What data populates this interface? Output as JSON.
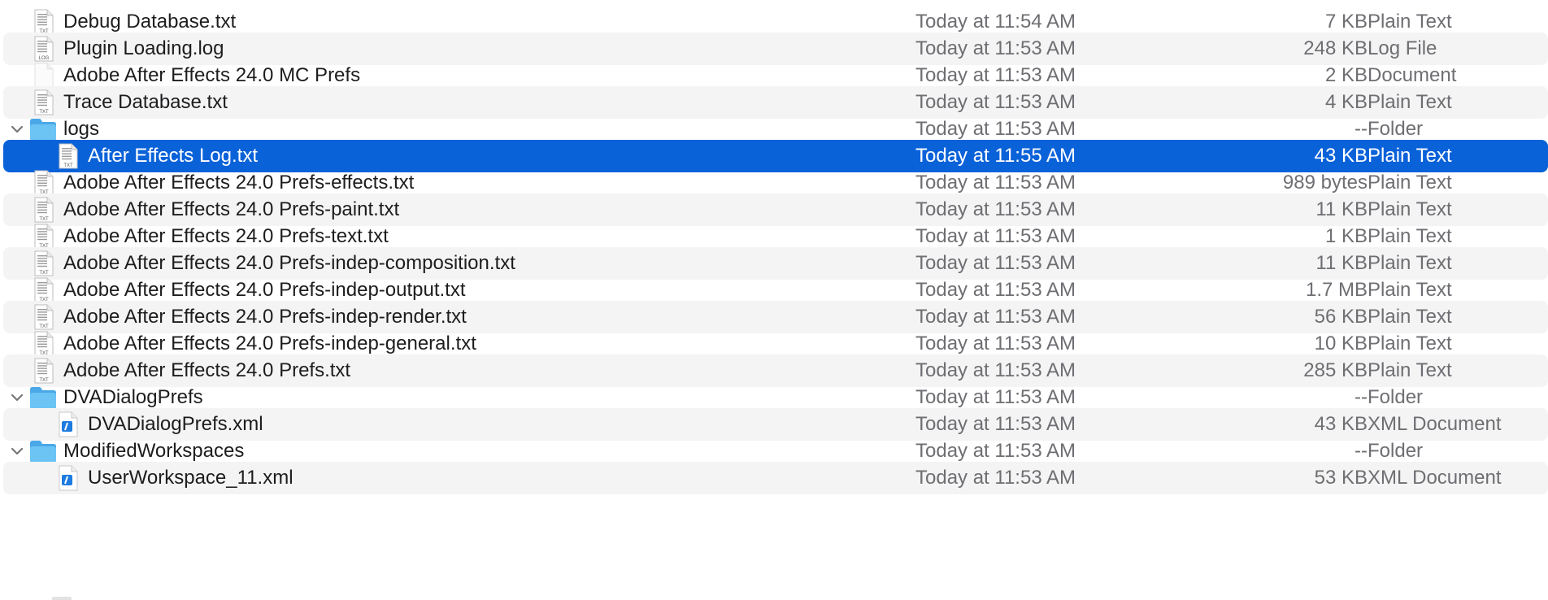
{
  "file_list": {
    "rows": [
      {
        "name": "Debug Database.txt",
        "date": "Today at 11:54 AM",
        "size": "7 KB",
        "kind": "Plain Text",
        "icon": "txt-file-icon",
        "level": 1,
        "disclosure": false,
        "selected": false
      },
      {
        "name": "Plugin Loading.log",
        "date": "Today at 11:53 AM",
        "size": "248 KB",
        "kind": "Log File",
        "icon": "log-file-icon",
        "level": 1,
        "disclosure": false,
        "selected": false
      },
      {
        "name": "Adobe After Effects 24.0 MC Prefs",
        "date": "Today at 11:53 AM",
        "size": "2 KB",
        "kind": "Document",
        "icon": "blank-document-icon",
        "level": 1,
        "disclosure": false,
        "selected": false
      },
      {
        "name": "Trace Database.txt",
        "date": "Today at 11:53 AM",
        "size": "4 KB",
        "kind": "Plain Text",
        "icon": "txt-file-icon",
        "level": 1,
        "disclosure": false,
        "selected": false
      },
      {
        "name": "logs",
        "date": "Today at 11:53 AM",
        "size": "--",
        "kind": "Folder",
        "icon": "folder-icon",
        "level": 1,
        "disclosure": true,
        "selected": false
      },
      {
        "name": "After Effects Log.txt",
        "date": "Today at 11:55 AM",
        "size": "43 KB",
        "kind": "Plain Text",
        "icon": "txt-file-icon",
        "level": 2,
        "disclosure": false,
        "selected": true
      },
      {
        "name": "Adobe After Effects 24.0 Prefs-effects.txt",
        "date": "Today at 11:53 AM",
        "size": "989 bytes",
        "kind": "Plain Text",
        "icon": "txt-file-icon",
        "level": 1,
        "disclosure": false,
        "selected": false
      },
      {
        "name": "Adobe After Effects 24.0 Prefs-paint.txt",
        "date": "Today at 11:53 AM",
        "size": "11 KB",
        "kind": "Plain Text",
        "icon": "txt-file-icon",
        "level": 1,
        "disclosure": false,
        "selected": false
      },
      {
        "name": "Adobe After Effects 24.0 Prefs-text.txt",
        "date": "Today at 11:53 AM",
        "size": "1 KB",
        "kind": "Plain Text",
        "icon": "txt-file-icon",
        "level": 1,
        "disclosure": false,
        "selected": false
      },
      {
        "name": "Adobe After Effects 24.0 Prefs-indep-composition.txt",
        "date": "Today at 11:53 AM",
        "size": "11 KB",
        "kind": "Plain Text",
        "icon": "txt-file-icon",
        "level": 1,
        "disclosure": false,
        "selected": false
      },
      {
        "name": "Adobe After Effects 24.0 Prefs-indep-output.txt",
        "date": "Today at 11:53 AM",
        "size": "1.7 MB",
        "kind": "Plain Text",
        "icon": "txt-file-icon",
        "level": 1,
        "disclosure": false,
        "selected": false
      },
      {
        "name": "Adobe After Effects 24.0 Prefs-indep-render.txt",
        "date": "Today at 11:53 AM",
        "size": "56 KB",
        "kind": "Plain Text",
        "icon": "txt-file-icon",
        "level": 1,
        "disclosure": false,
        "selected": false
      },
      {
        "name": "Adobe After Effects 24.0 Prefs-indep-general.txt",
        "date": "Today at 11:53 AM",
        "size": "10 KB",
        "kind": "Plain Text",
        "icon": "txt-file-icon",
        "level": 1,
        "disclosure": false,
        "selected": false
      },
      {
        "name": "Adobe After Effects 24.0 Prefs.txt",
        "date": "Today at 11:53 AM",
        "size": "285 KB",
        "kind": "Plain Text",
        "icon": "txt-file-icon",
        "level": 1,
        "disclosure": false,
        "selected": false
      },
      {
        "name": "DVADialogPrefs",
        "date": "Today at 11:53 AM",
        "size": "--",
        "kind": "Folder",
        "icon": "folder-icon",
        "level": 1,
        "disclosure": true,
        "selected": false
      },
      {
        "name": "DVADialogPrefs.xml",
        "date": "Today at 11:53 AM",
        "size": "43 KB",
        "kind": "XML Document",
        "icon": "xml-file-icon",
        "level": 2,
        "disclosure": false,
        "selected": false
      },
      {
        "name": "ModifiedWorkspaces",
        "date": "Today at 11:53 AM",
        "size": "--",
        "kind": "Folder",
        "icon": "folder-icon",
        "level": 1,
        "disclosure": true,
        "selected": false
      },
      {
        "name": "UserWorkspace_11.xml",
        "date": "Today at 11:53 AM",
        "size": "53 KB",
        "kind": "XML Document",
        "icon": "xml-file-icon",
        "level": 2,
        "disclosure": false,
        "selected": false
      }
    ]
  },
  "colors": {
    "selection": "#0a62d9",
    "alt_row": "#f4f4f4",
    "folder": "#5ab8f0",
    "secondary_text": "#6e6e73"
  }
}
